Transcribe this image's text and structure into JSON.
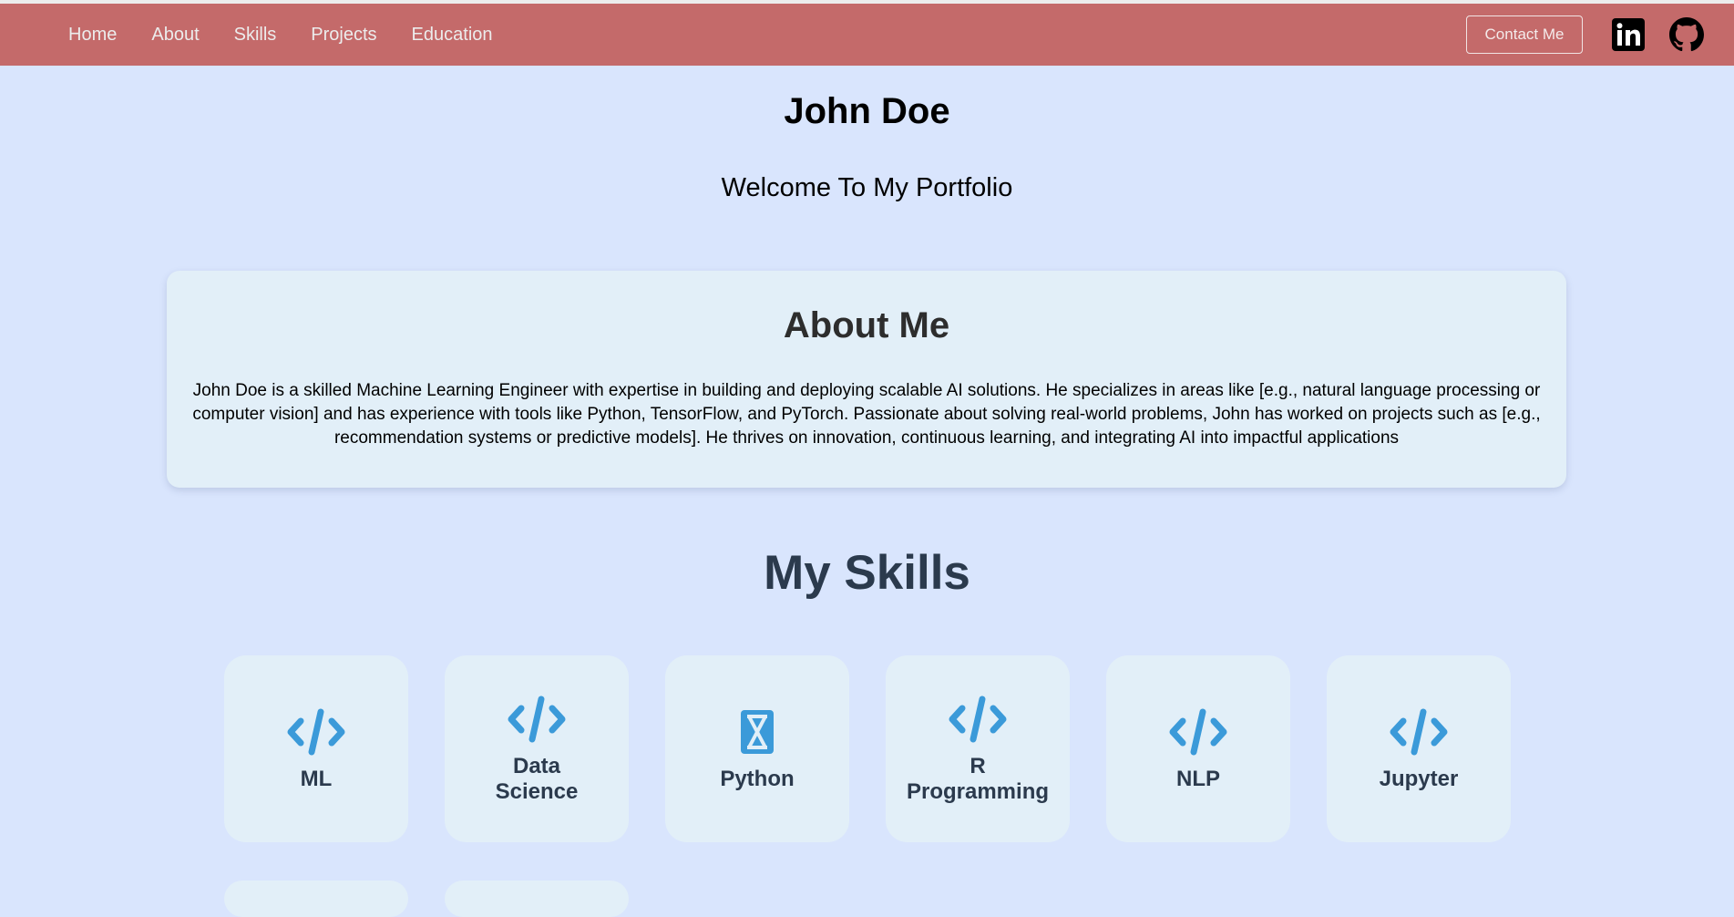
{
  "nav": {
    "links": [
      "Home",
      "About",
      "Skills",
      "Projects",
      "Education"
    ],
    "contact_label": "Contact Me",
    "social": [
      {
        "icon": "linkedin-icon"
      },
      {
        "icon": "github-icon"
      }
    ],
    "bar_color": "#c46a6a"
  },
  "hero": {
    "name": "John Doe",
    "tagline": "Welcome To My Portfolio"
  },
  "about": {
    "title": "About Me",
    "text": "John Doe is a skilled Machine Learning Engineer with expertise in building and deploying scalable AI solutions. He specializes in areas like [e.g., natural language processing or computer vision] and has experience with tools like Python, TensorFlow, and PyTorch. Passionate about solving real-world problems, John has worked on projects such as [e.g., recommendation systems or predictive models]. He thrives on innovation, continuous learning, and integrating AI into impactful applications"
  },
  "skills": {
    "title": "My Skills",
    "items": [
      {
        "label": "ML",
        "icon": "code-icon"
      },
      {
        "label": "Data Science",
        "icon": "code-icon"
      },
      {
        "label": "Python",
        "icon": "hourglass-icon"
      },
      {
        "label": "R Programming",
        "icon": "code-icon"
      },
      {
        "label": "NLP",
        "icon": "code-icon"
      },
      {
        "label": "Jupyter",
        "icon": "code-icon"
      }
    ],
    "icon_color": "#3b9ad9"
  }
}
